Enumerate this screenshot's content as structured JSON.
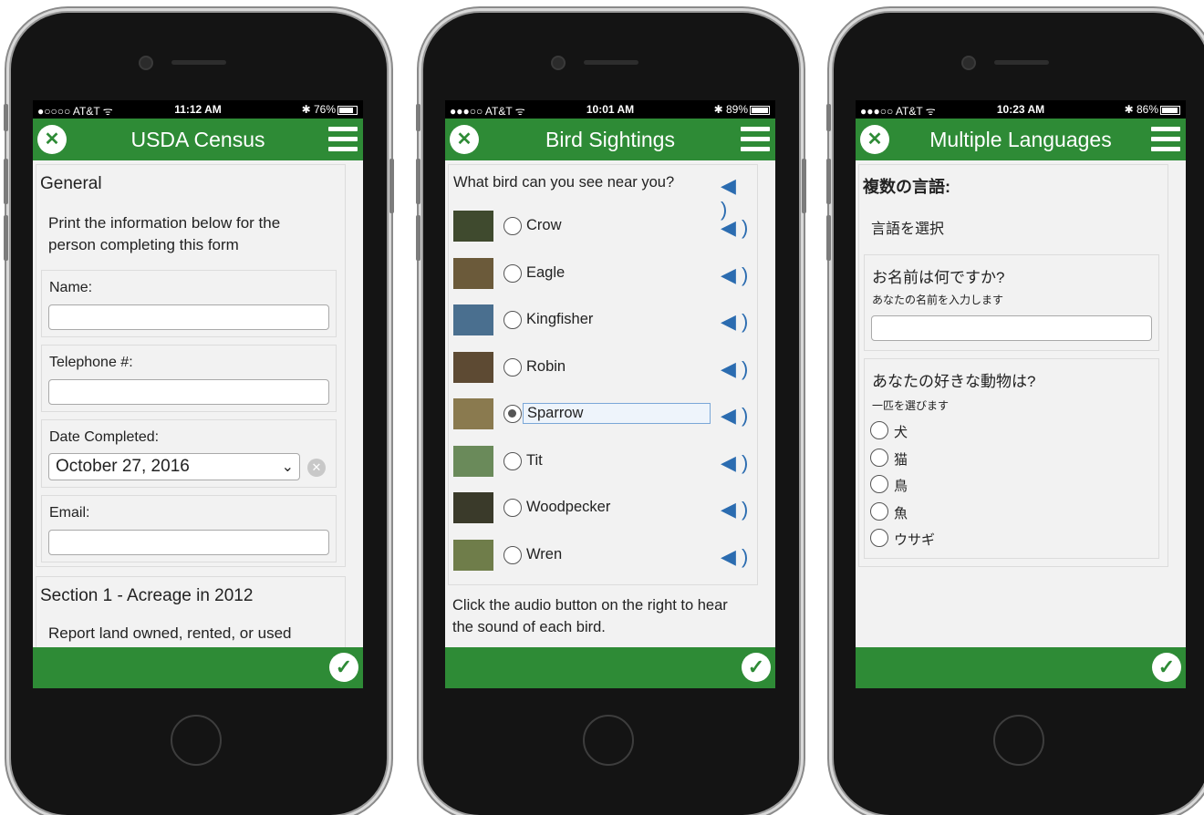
{
  "colors": {
    "header_green": "#2e8b36",
    "speaker_blue": "#2b6cb0"
  },
  "phones": [
    {
      "status": {
        "carrier": "●○○○○ AT&T ᯤ",
        "time": "11:12 AM",
        "battery": "76%"
      },
      "header": {
        "title": "USDA Census"
      },
      "form": {
        "section": "General",
        "instructions": "Print the information below for the person completing this form",
        "name_label": "Name:",
        "phone_label": "Telephone #:",
        "date_label": "Date Completed:",
        "date_value": "October 27, 2016",
        "email_label": "Email:",
        "section2": "Section 1 - Acreage in 2012",
        "section2_text": "Report land owned, rented, or used"
      }
    },
    {
      "status": {
        "carrier": "●●●○○ AT&T ᯤ",
        "time": "10:01 AM",
        "battery": "89%"
      },
      "header": {
        "title": "Bird Sightings"
      },
      "question": "What bird can you see near you?",
      "options": [
        "Crow",
        "Eagle",
        "Kingfisher",
        "Robin",
        "Sparrow",
        "Tit",
        "Woodpecker",
        "Wren"
      ],
      "selected": "Sparrow",
      "footer_text": "Click the audio button on the right to hear the sound of each bird."
    },
    {
      "status": {
        "carrier": "●●●○○ AT&T ᯤ",
        "time": "10:23 AM",
        "battery": "86%"
      },
      "header": {
        "title": "Multiple Languages"
      },
      "heading": "複数の言語:",
      "select_language": "言語を選択",
      "name_question": "お名前は何ですか?",
      "name_hint": "あなたの名前を入力します",
      "animal_question": "あなたの好きな動物は?",
      "animal_hint": "一匹を選びます",
      "animals": [
        "犬",
        "猫",
        "鳥",
        "魚",
        "ウサギ"
      ]
    }
  ]
}
